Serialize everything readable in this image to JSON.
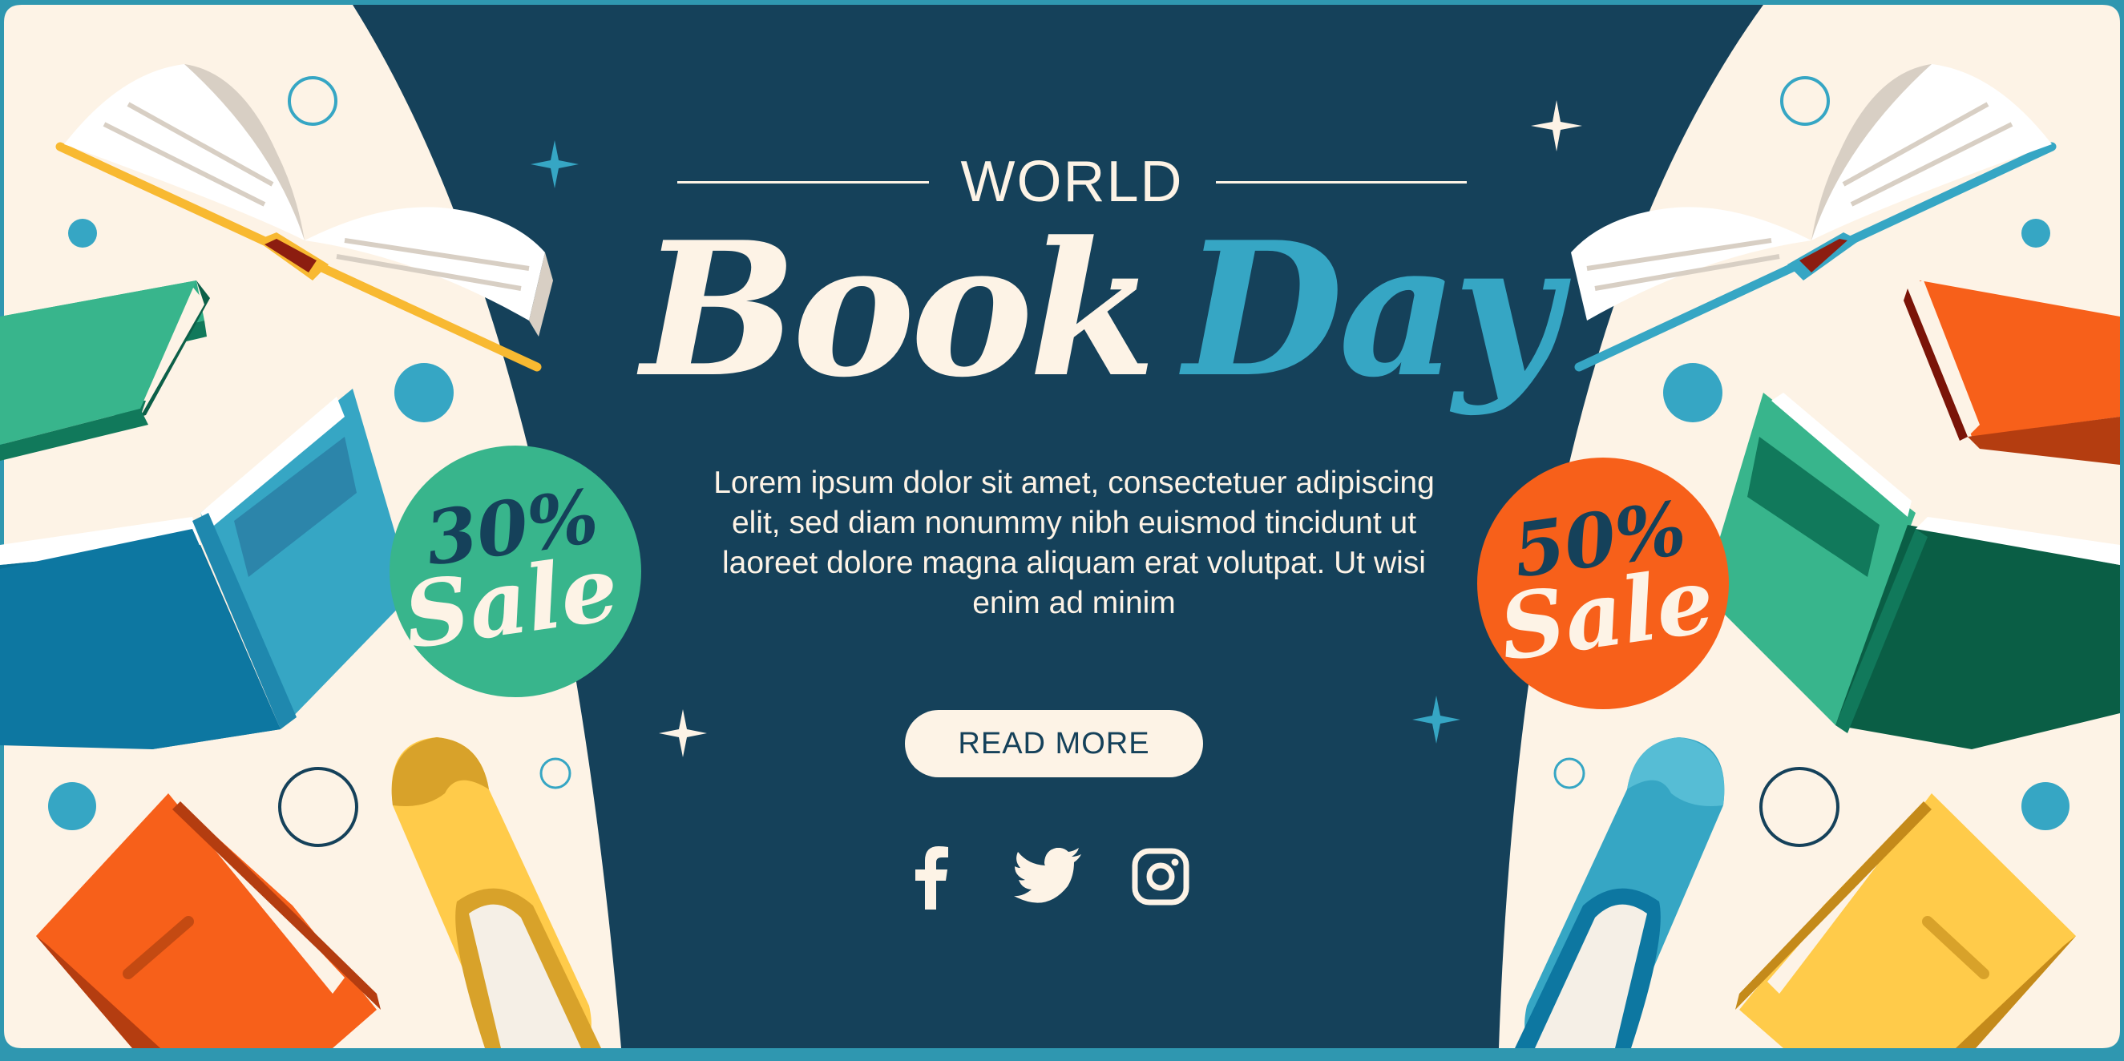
{
  "banner": {
    "world": "WORLD",
    "title_part1": "Book",
    "title_part2": "Day",
    "description": "Lorem ipsum dolor sit amet, consectetuer adipiscing elit, sed diam nonummy nibh euismod tincidunt ut laoreet dolore magna aliquam erat volutpat. Ut wisi enim ad minim",
    "button_label": "READ MORE"
  },
  "badges": {
    "left": {
      "percent": "30%",
      "label": "Sale"
    },
    "right": {
      "percent": "50%",
      "label": "Sale"
    }
  },
  "social": {
    "icons": [
      "facebook-icon",
      "twitter-icon",
      "instagram-icon"
    ]
  },
  "colors": {
    "navy": "#15415a",
    "cream": "#fdf3e6",
    "teal_blue": "#36a6c4",
    "green": "#38b58c",
    "orange": "#f7601a",
    "yellow": "#ffcb4a",
    "border": "#2f97b0"
  }
}
